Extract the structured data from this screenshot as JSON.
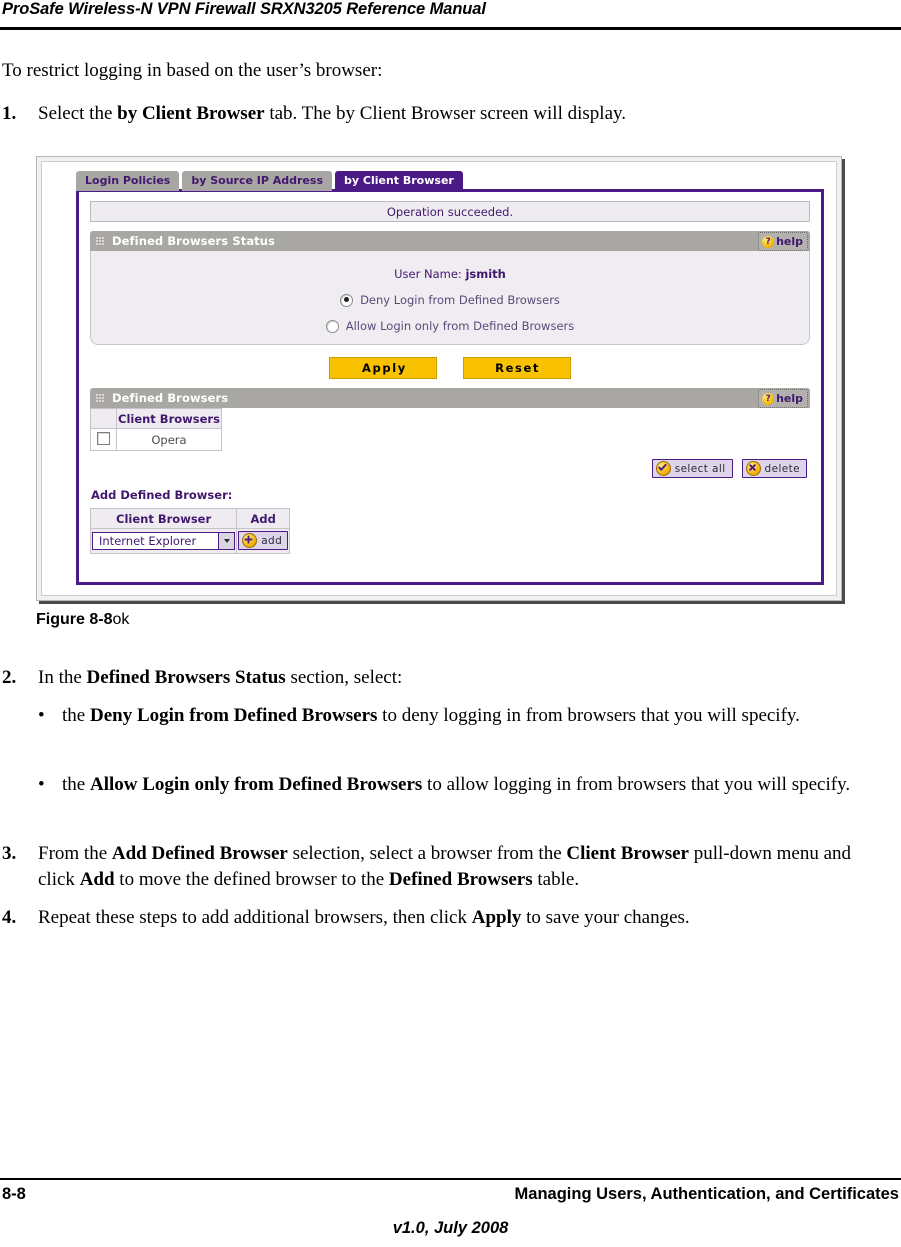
{
  "header": {
    "running_title": "ProSafe Wireless-N VPN Firewall SRXN3205 Reference Manual"
  },
  "body": {
    "intro": "To restrict logging in based on the user’s browser:",
    "step1": {
      "num": "1.",
      "part1": "Select the ",
      "bold1": "by Client Browser",
      "part2": " tab. The by Client Browser screen will display."
    },
    "step2": {
      "num": "2.",
      "part1": "In the ",
      "bold1": "Defined Browsers Status",
      "part2": " section, select:"
    },
    "bullet1": {
      "dot": "•",
      "part1": "the ",
      "bold1": "Deny Login from Defined Browsers",
      "part2": " to deny logging in from browsers that you will specify."
    },
    "bullet2": {
      "dot": "•",
      "part1": "the ",
      "bold1": "Allow Login only from Defined Browsers",
      "part2": " to allow logging in from browsers that you will specify."
    },
    "step3": {
      "num": "3.",
      "part1": "From the ",
      "bold1": "Add Defined Browser",
      "part2": " selection, select a browser from the ",
      "bold2": "Client Browser",
      "part3": " pull-down menu and click ",
      "bold3": "Add",
      "part4": " to move the defined browser to the ",
      "bold4": "Defined Browsers",
      "part5": " table."
    },
    "step4": {
      "num": "4.",
      "part1": "Repeat these steps to add additional browsers, then click ",
      "bold1": "Apply",
      "part2": " to save your changes."
    }
  },
  "figure": {
    "caption_number": "Figure 8-8",
    "caption_text": "ok"
  },
  "screenshot": {
    "tabs": [
      {
        "label": "Login Policies",
        "active": false
      },
      {
        "label": "by Source IP Address",
        "active": false
      },
      {
        "label": "by Client Browser",
        "active": true
      }
    ],
    "status_message": "Operation succeeded.",
    "status_section": {
      "title": "Defined Browsers Status",
      "help_label": "help",
      "help_icon_glyph": "?",
      "user_name_label": "User Name:",
      "user_name_value": "jsmith",
      "options": [
        {
          "label": "Deny Login from Defined Browsers",
          "selected": true
        },
        {
          "label": "Allow Login only from Defined Browsers",
          "selected": false
        }
      ]
    },
    "buttons": {
      "apply": "Apply",
      "reset": "Reset"
    },
    "defined_browsers_section": {
      "title": "Defined Browsers",
      "help_label": "help",
      "help_icon_glyph": "?",
      "column_header": "Client Browsers",
      "rows": [
        {
          "browser": "Opera",
          "checked": false
        }
      ],
      "select_all_label": "select all",
      "delete_label": "delete"
    },
    "add_defined_browser": {
      "label": "Add Defined Browser:",
      "column_header_browser": "Client Browser",
      "column_header_add": "Add",
      "selected_browser": "Internet Explorer",
      "add_button_label": "add"
    },
    "colors": {
      "accent_purple": "#4b1a86",
      "header_grey": "#a9a7a4",
      "gold": "#f8c200",
      "panel_bg": "#efedf1"
    }
  },
  "footer": {
    "page_number": "8-8",
    "chapter": "Managing Users, Authentication, and Certificates",
    "version": "v1.0, July 2008"
  }
}
